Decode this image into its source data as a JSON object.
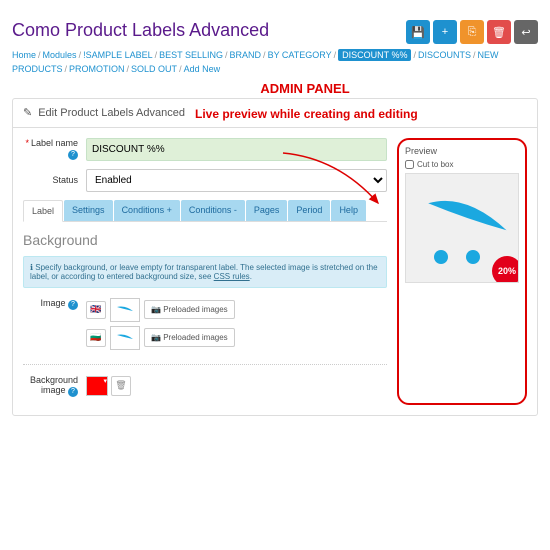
{
  "title": "Como Product Labels Advanced",
  "crumbs": [
    "Home",
    "Modules",
    "!SAMPLE LABEL",
    "BEST SELLING",
    "BRAND",
    "BY CATEGORY",
    "DISCOUNT %%",
    "DISCOUNTS",
    "NEW PRODUCTS",
    "PROMOTION",
    "SOLD OUT",
    "Add New"
  ],
  "crumb_active_idx": 6,
  "annot": {
    "title": "ADMIN PANEL",
    "sub": "Live preview while creating and editing"
  },
  "panel_title": "Edit Product Labels Advanced",
  "form": {
    "label_name_lbl": "Label name",
    "label_name_val": "DISCOUNT %%",
    "status_lbl": "Status",
    "status_val": "Enabled",
    "image_lbl": "Image",
    "bg_lbl": "Background image",
    "preload_btn": "Preloaded images"
  },
  "tabs": [
    "Label",
    "Settings",
    "Conditions +",
    "Conditions -",
    "Pages",
    "Period",
    "Help"
  ],
  "active_tab": 0,
  "section": "Background",
  "info": {
    "text": "Specify background, or leave empty for transparent label. The selected image is stretched on the label, or according to entered background size, see ",
    "link": "CSS rules"
  },
  "preview": {
    "label": "Preview",
    "cut": "Cut to box",
    "badge": "20%"
  }
}
